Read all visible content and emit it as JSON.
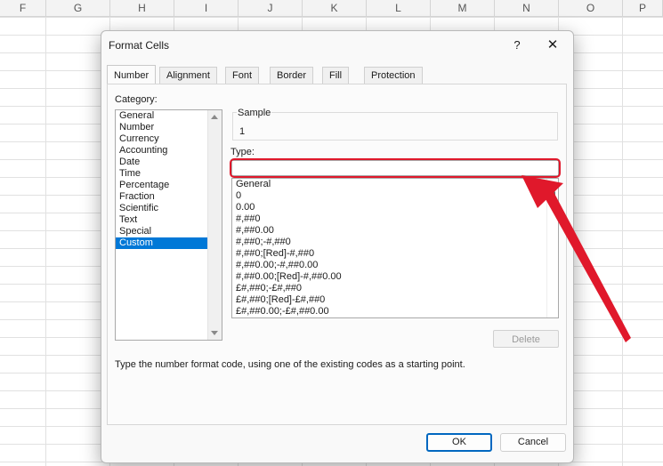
{
  "sheet": {
    "columns": [
      "F",
      "G",
      "H",
      "I",
      "J",
      "K",
      "L",
      "M",
      "N",
      "O",
      "P"
    ]
  },
  "dialog": {
    "title": "Format Cells",
    "help": "?",
    "close": "✕",
    "tabs": [
      "Number",
      "Alignment",
      "Font",
      "Border",
      "Fill",
      "Protection"
    ],
    "active_tab": "Number",
    "category_label": "Category:",
    "categories": [
      "General",
      "Number",
      "Currency",
      "Accounting",
      "Date",
      "Time",
      "Percentage",
      "Fraction",
      "Scientific",
      "Text",
      "Special",
      "Custom"
    ],
    "selected_category": "Custom",
    "sample_label": "Sample",
    "sample_value": "1",
    "type_label": "Type:",
    "type_value": "",
    "formats": [
      "General",
      "0",
      "0.00",
      "#,##0",
      "#,##0.00",
      "#,##0;-#,##0",
      "#,##0;[Red]-#,##0",
      "#,##0.00;-#,##0.00",
      "#,##0.00;[Red]-#,##0.00",
      "£#,##0;-£#,##0",
      "£#,##0;[Red]-£#,##0",
      "£#,##0.00;-£#,##0.00"
    ],
    "delete_label": "Delete",
    "description": "Type the number format code, using one of the existing codes as a starting point.",
    "ok_label": "OK",
    "cancel_label": "Cancel"
  },
  "annotation": {
    "highlight_color": "#e0182b"
  }
}
